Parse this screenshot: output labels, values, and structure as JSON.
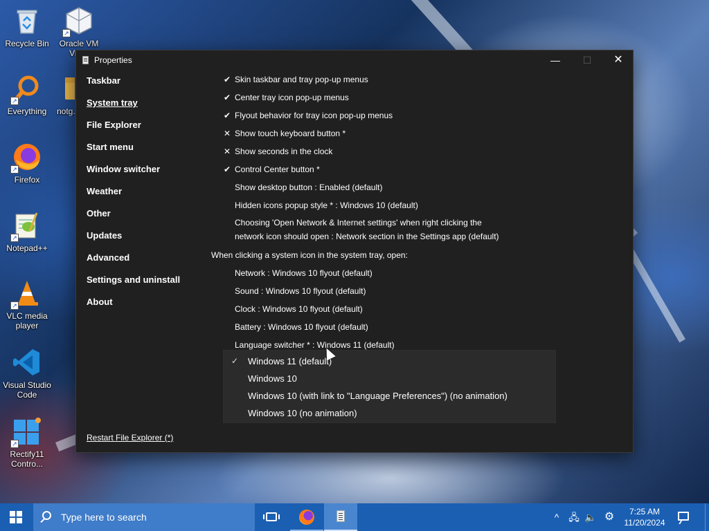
{
  "desktop": {
    "icons": [
      {
        "label": "Recycle Bin"
      },
      {
        "label": "Oracle VM Virt..."
      },
      {
        "label": "Everything"
      },
      {
        "label": "notg..."
      },
      {
        "label": "Firefox"
      },
      {
        "label": "Notepad++"
      },
      {
        "label": "VLC media player"
      },
      {
        "label": "Visual Studio Code"
      },
      {
        "label": "Rectify11 Contro..."
      }
    ]
  },
  "window": {
    "title": "Properties",
    "controls": {
      "minimize": "—",
      "maximize": "☐",
      "close": "✕"
    }
  },
  "sidebar": {
    "items": [
      {
        "label": "Taskbar"
      },
      {
        "label": "System tray"
      },
      {
        "label": "File Explorer"
      },
      {
        "label": "Start menu"
      },
      {
        "label": "Window switcher"
      },
      {
        "label": "Weather"
      },
      {
        "label": "Other"
      },
      {
        "label": "Updates"
      },
      {
        "label": "Advanced"
      },
      {
        "label": "Settings and uninstall"
      },
      {
        "label": "About"
      }
    ],
    "active": "System tray",
    "restart_link": "Restart File Explorer (*)"
  },
  "options": [
    {
      "mark": "✔",
      "label": "Skin taskbar and tray pop-up menus"
    },
    {
      "mark": "✔",
      "label": "Center tray icon pop-up menus"
    },
    {
      "mark": "✔",
      "label": "Flyout behavior for tray icon pop-up menus"
    },
    {
      "mark": "✕",
      "label": "Show touch keyboard button *"
    },
    {
      "mark": "✕",
      "label": "Show seconds in the clock"
    },
    {
      "mark": "✔",
      "label": "Control Center button *"
    },
    {
      "mark": "",
      "label": "Show desktop button : Enabled (default)"
    },
    {
      "mark": "",
      "label": "Hidden icons popup style * : Windows 10 (default)"
    }
  ],
  "network_option": {
    "line1": "Choosing 'Open Network & Internet settings' when right clicking the",
    "line2": "network icon should open : Network section in the Settings app (default)"
  },
  "section_header": "When clicking a system icon in the system tray, open:",
  "tray_options": [
    {
      "label": "Network : Windows 10 flyout (default)"
    },
    {
      "label": "Sound : Windows 10 flyout (default)"
    },
    {
      "label": "Clock : Windows 10 flyout (default)"
    },
    {
      "label": "Battery : Windows 10 flyout (default)"
    },
    {
      "label": "Language switcher * : Windows 11 (default)"
    }
  ],
  "dropdown": {
    "items": [
      {
        "label": "Windows 11 (default)",
        "checked": true
      },
      {
        "label": "Windows 10",
        "checked": false
      },
      {
        "label": "Windows 10 (with link to \"Language Preferences\") (no animation)",
        "checked": false
      },
      {
        "label": "Windows 10 (no animation)",
        "checked": false
      }
    ],
    "check_glyph": "✓"
  },
  "taskbar": {
    "search_placeholder": "Type here to search",
    "tray": {
      "chevron": "^",
      "network": "🖧",
      "volume": "🔈",
      "settings": "⚙"
    },
    "time": "7:25 AM",
    "date": "11/20/2024"
  },
  "colors": {
    "window_bg": "#202020",
    "dropdown_bg": "#2b2b2b",
    "taskbar_bg": "#1b5fb3",
    "search_bg": "#3f7cc9"
  }
}
